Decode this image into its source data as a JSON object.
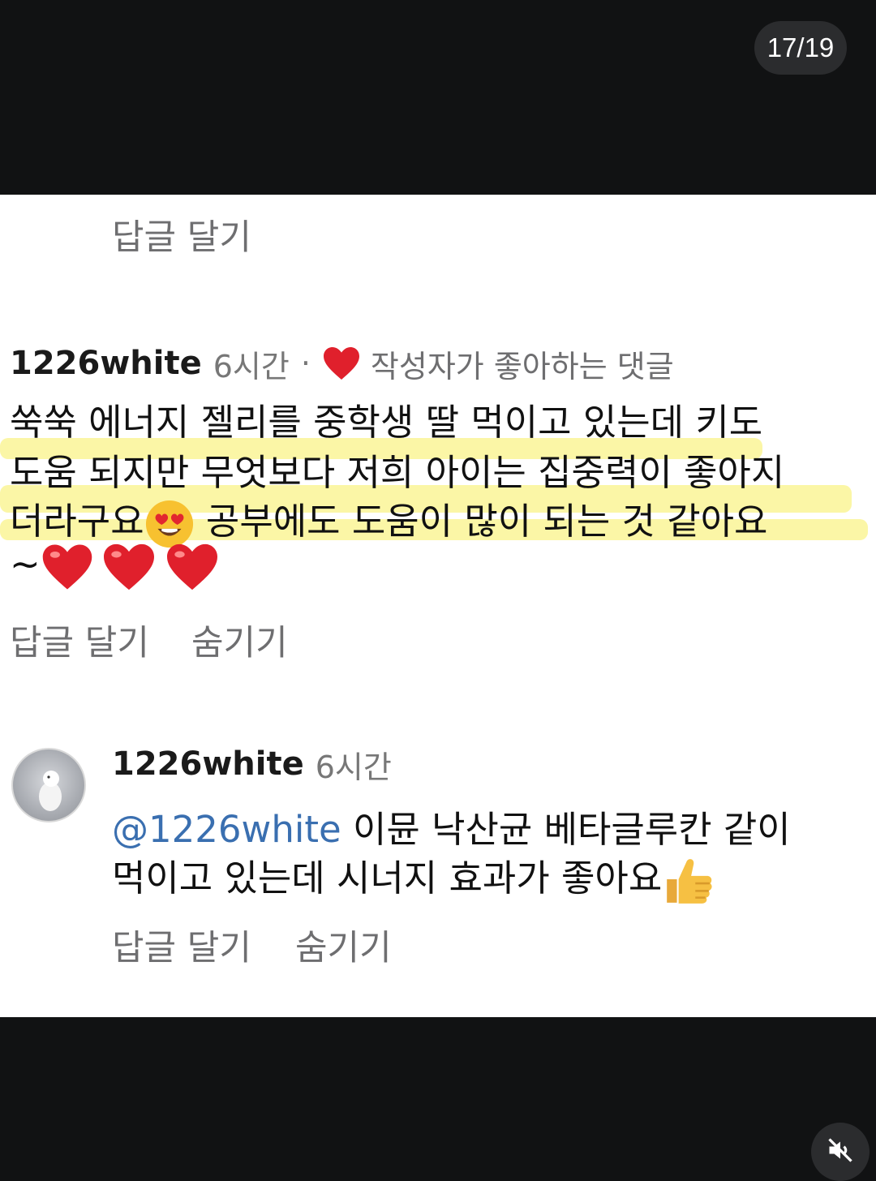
{
  "page_counter": "17/19",
  "top_reply": {
    "reply_label": "답글 달기"
  },
  "comment1": {
    "username": "1226white",
    "time": "6시간",
    "dot": "·",
    "liked_label": "작성자가 좋아하는 댓글",
    "lines": [
      "쑥쑥 에너지 젤리를 중학생 딸 먹이고 있는데 키도",
      "도움 되지만 무엇보다 저희 아이는 집중력이 좋아지",
      "더라구요",
      " 공부에도 도움이 많이 되는 것 같아요",
      "~"
    ],
    "reply_label": "답글 달기",
    "hide_label": "숨기기",
    "icons": [
      "heart-eyes-emoji",
      "red-heart-emoji",
      "red-heart-emoji",
      "red-heart-emoji"
    ],
    "highlight_color": "#fbf6a6"
  },
  "comment2": {
    "username": "1226white",
    "time": "6시간",
    "mention": "@1226white",
    "line1_rest": " 이뮨 낙산균 베타글루칸 같이",
    "line2": "먹이고 있는데 시너지 효과가 좋아요",
    "reply_label": "답글 달기",
    "hide_label": "숨기기",
    "icons": [
      "avatar",
      "thumbs-up-emoji"
    ]
  },
  "colors": {
    "background": "#111213",
    "panel": "#ffffff",
    "mention": "#3a6fb0",
    "heart": "#e0202c"
  }
}
